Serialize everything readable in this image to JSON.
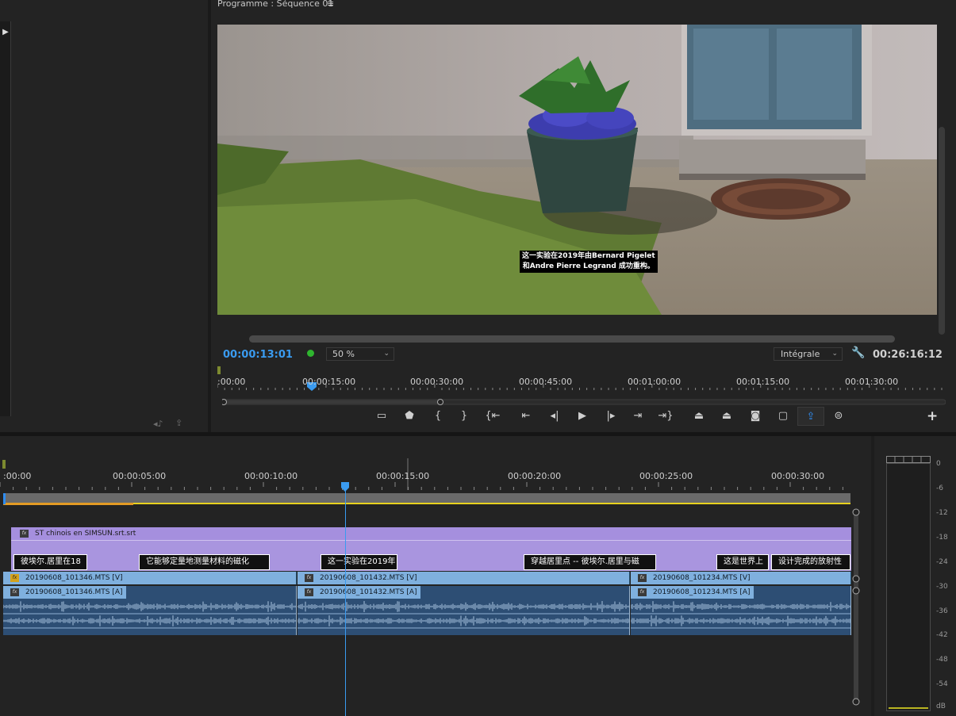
{
  "program_monitor": {
    "title": "Programme : Séquence 01",
    "subtitle_line1": "这一实验在2019年由Bernard Pigelet",
    "subtitle_line2": "和Andre Pierre Legrand 成功重构。",
    "timecode_current": "00:00:13:01",
    "zoom_value": "50 %",
    "quality_value": "Intégrale",
    "timecode_duration": "00:26:16:12",
    "ruler_labels": [
      ":00:00",
      "00:00:15:00",
      "00:00:30:00",
      "00:00:45:00",
      "00:01:00:00",
      "00:01:15:00",
      "00:01:30:00"
    ],
    "accent_color": "#3a9bf0"
  },
  "timeline": {
    "ruler_labels": [
      ":00:00",
      "00:00:05:00",
      "00:00:10:00",
      "00:00:15:00",
      "00:00:20:00",
      "00:00:25:00",
      "00:00:30:00"
    ],
    "subtitle_track_name": "ST chinois en SIMSUN.srt.srt",
    "subtitle_clips": [
      "彼埃尔.居里在18",
      "它能够定量地测量材料的磁化",
      "这一实验在2019年",
      "穿越居里点 -- 彼埃尔.居里与磁",
      "这是世界上",
      "设计完成的放射性"
    ],
    "video_clips": [
      "20190608_101346.MTS [V]",
      "20190608_101432.MTS [V]",
      "20190608_101234.MTS [V]"
    ],
    "audio_clips": [
      "20190608_101346.MTS [A]",
      "20190608_101432.MTS [A]",
      "20190608_101234.MTS [A]"
    ]
  },
  "audio_meter": {
    "db_labels": [
      "0",
      "-6",
      "-12",
      "-18",
      "-24",
      "-30",
      "-36",
      "-42",
      "-48",
      "-54",
      "dB"
    ]
  },
  "icons": {
    "controls": [
      "safe-margins-icon",
      "add-marker-icon",
      "mark-in-icon",
      "mark-out-icon",
      "go-to-in-icon",
      "step-back-icon",
      "step-back-frame-icon",
      "play-icon",
      "step-forward-frame-icon",
      "step-forward-icon",
      "go-to-out-icon",
      "lift-icon",
      "extract-icon",
      "export-frame-icon",
      "comment-icon",
      "export-icon",
      "vr-icon"
    ]
  }
}
